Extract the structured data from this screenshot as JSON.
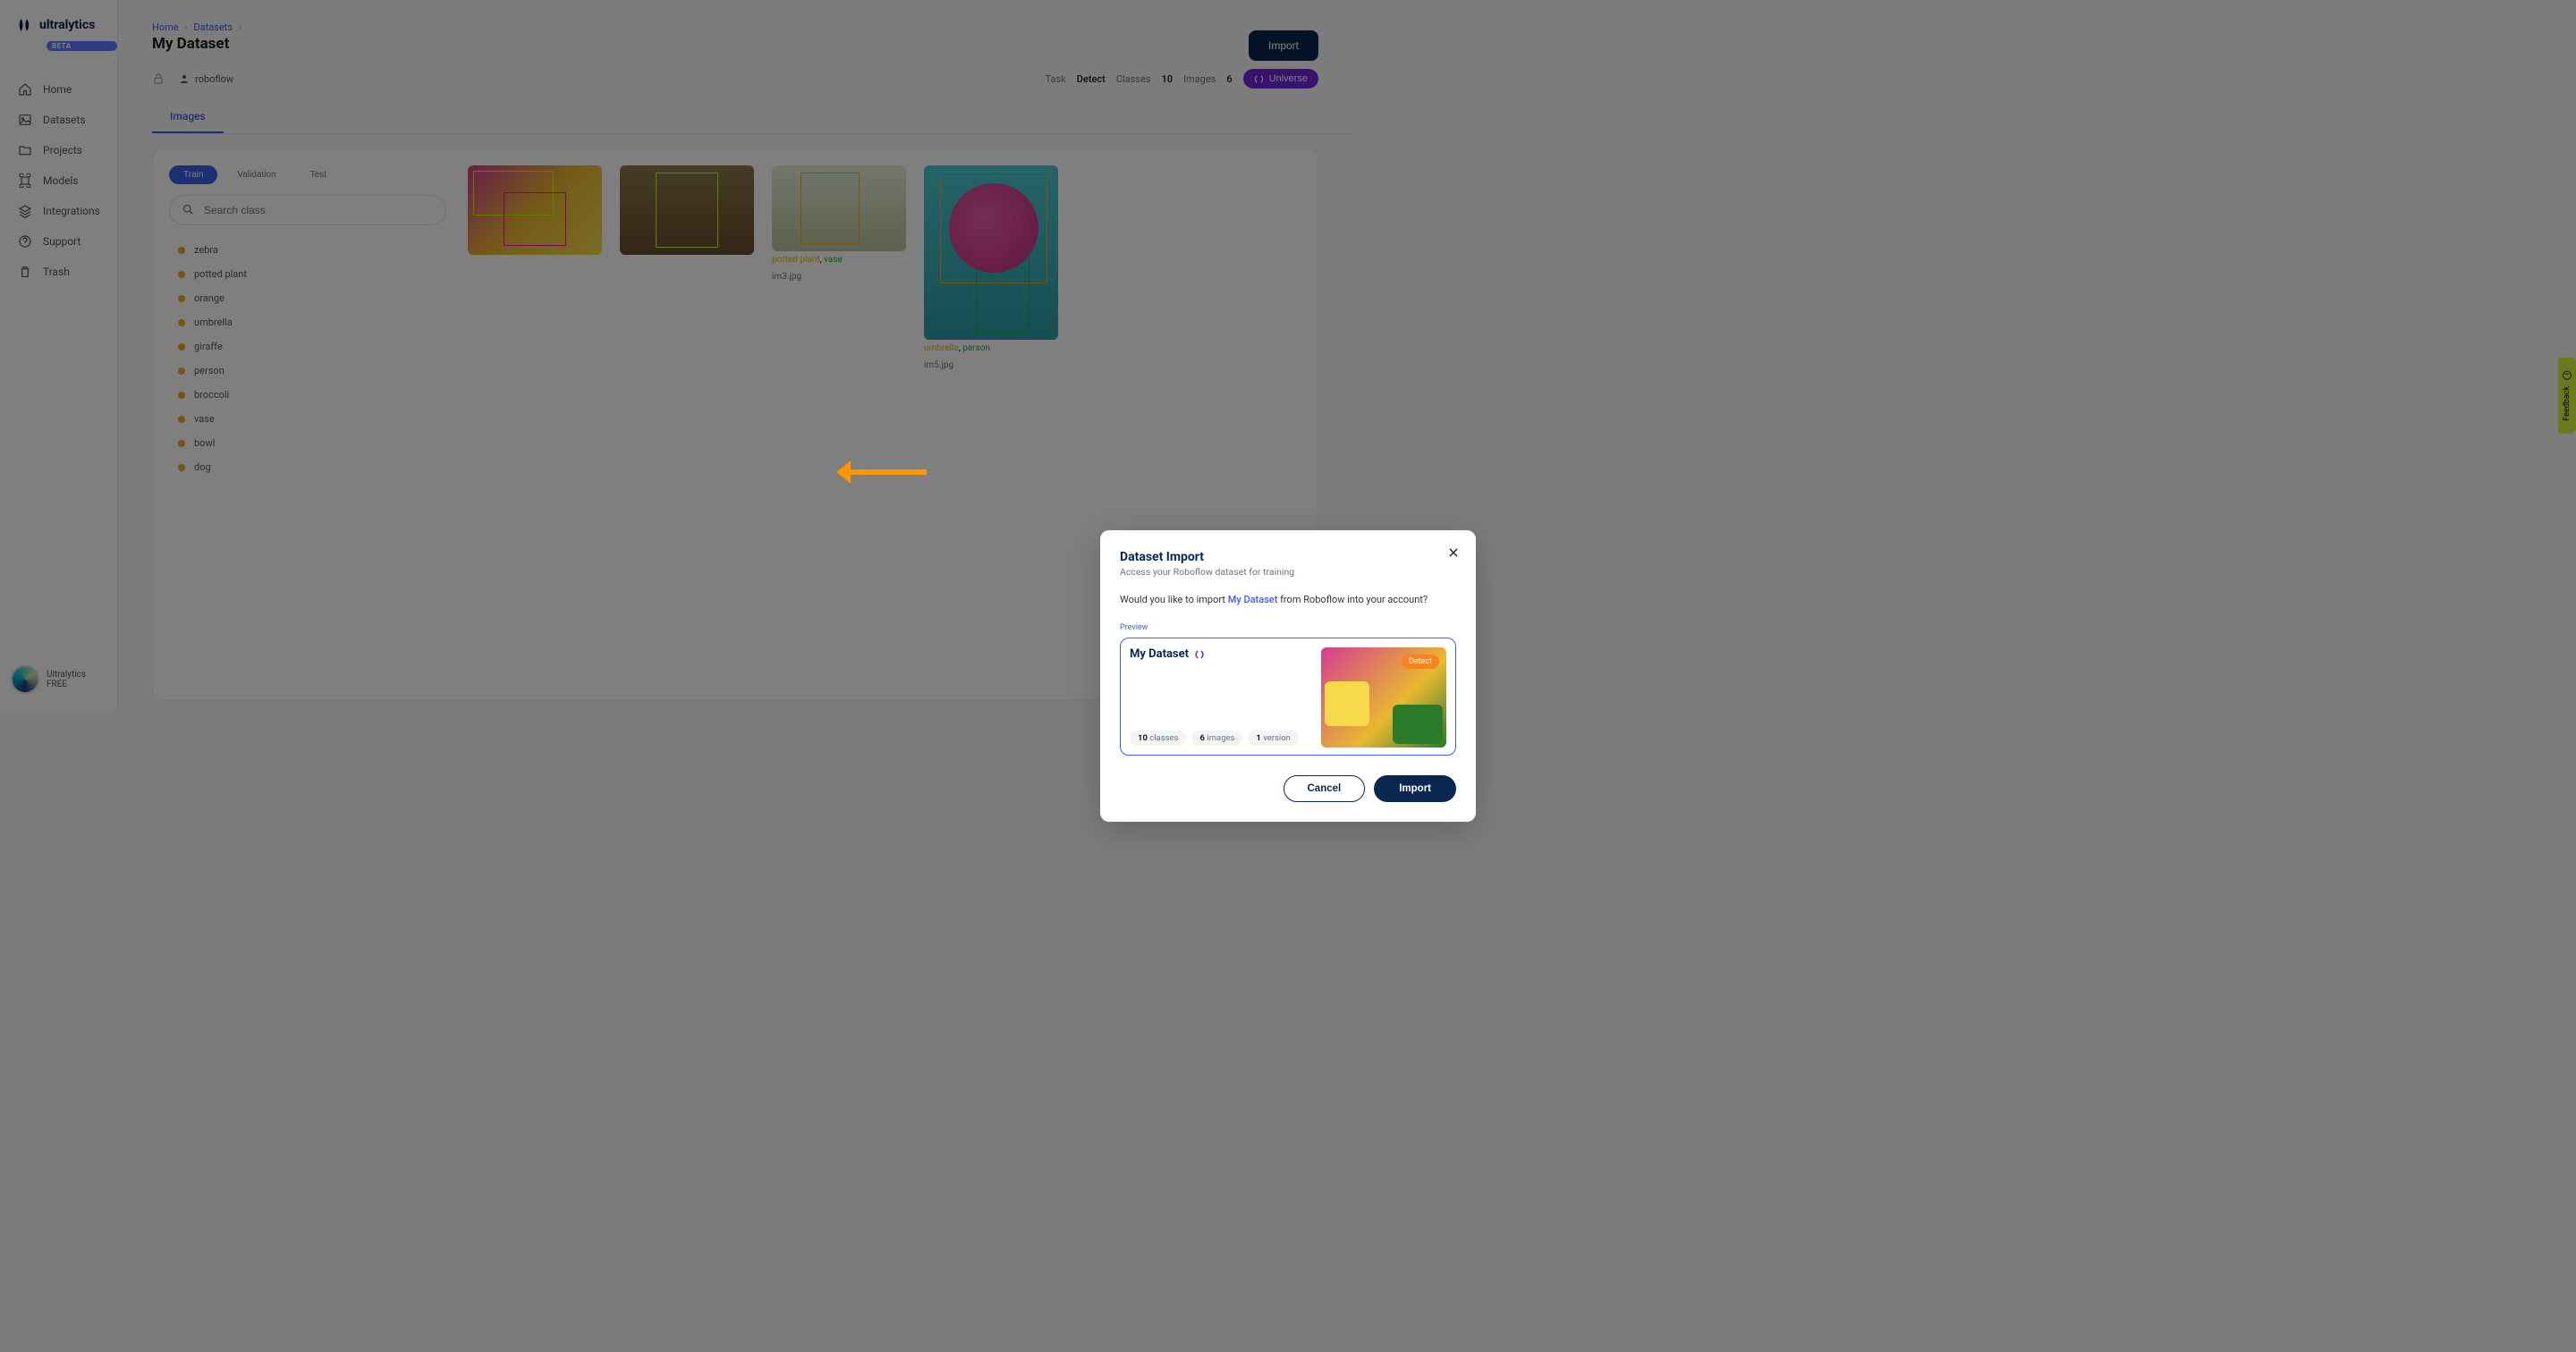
{
  "brand": {
    "name": "ultralytics",
    "badge": "BETA"
  },
  "sidebar": {
    "items": [
      {
        "label": "Home"
      },
      {
        "label": "Datasets"
      },
      {
        "label": "Projects"
      },
      {
        "label": "Models"
      },
      {
        "label": "Integrations"
      },
      {
        "label": "Support"
      },
      {
        "label": "Trash"
      }
    ]
  },
  "user": {
    "name": "Ultralytics",
    "plan": "FREE"
  },
  "breadcrumbs": {
    "home": "Home",
    "datasets": "Datasets"
  },
  "page": {
    "title": "My Dataset",
    "owner": "roboflow"
  },
  "header_actions": {
    "import": "Import"
  },
  "stats": {
    "task_label": "Task",
    "task_value": "Detect",
    "classes_label": "Classes",
    "classes_value": "10",
    "images_label": "Images",
    "images_value": "6",
    "universe_label": "Universe"
  },
  "tabs": {
    "images": "Images"
  },
  "splits": {
    "train": "Train",
    "validation": "Validation",
    "test": "Test"
  },
  "search": {
    "placeholder": "Search class"
  },
  "classes": [
    "zebra",
    "potted plant",
    "orange",
    "umbrella",
    "giraffe",
    "person",
    "broccoli",
    "vase",
    "bowl",
    "dog"
  ],
  "gallery": [
    {
      "file": "im3.jpg",
      "tags": [
        "potted plant",
        "vase"
      ]
    },
    {
      "file": "im5.jpg",
      "tags": [
        "umbrella",
        "person"
      ]
    }
  ],
  "feedback": {
    "label": "Feedback"
  },
  "modal": {
    "title": "Dataset Import",
    "subtitle": "Access your Roboflow dataset for training",
    "question_pre": "Would you like to import ",
    "dataset_name": "My Dataset",
    "question_post": " from Roboflow into your account?",
    "preview_label": "Preview",
    "preview_name": "My Dataset",
    "detect_badge": "Detect",
    "chips": {
      "classes_n": "10",
      "classes_t": "classes",
      "images_n": "6",
      "images_t": "images",
      "version_n": "1",
      "version_t": "version"
    },
    "cancel": "Cancel",
    "import": "Import"
  }
}
